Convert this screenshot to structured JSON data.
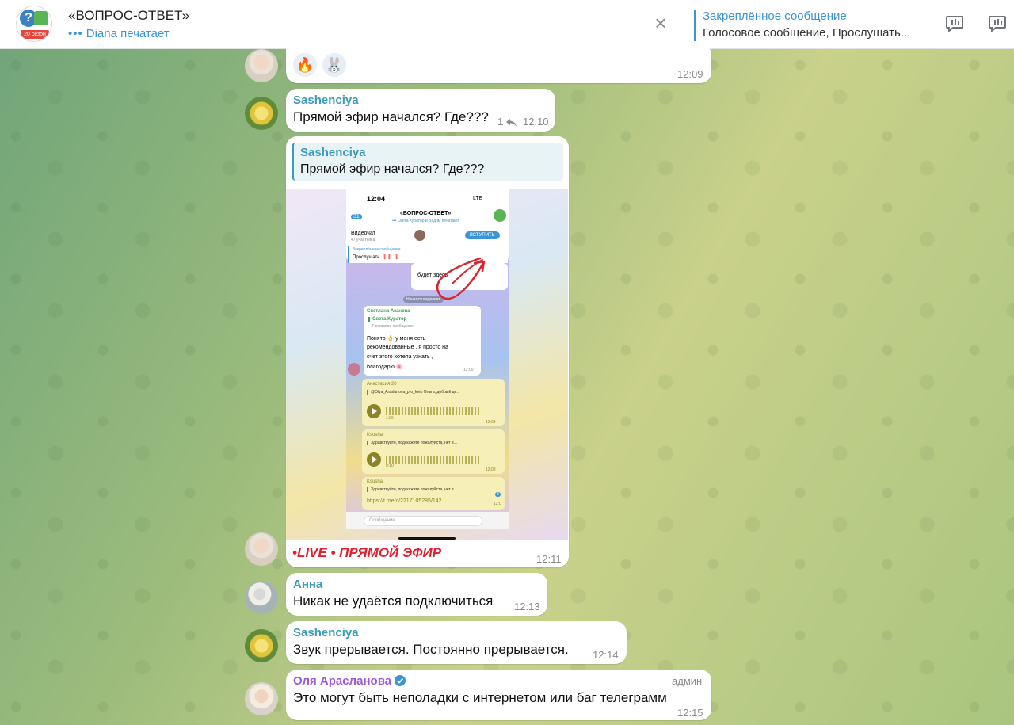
{
  "header": {
    "title": "«ВОПРОС-ОТВЕТ»",
    "status": "Diana печатает",
    "status_dots": "•••",
    "avatar_badge": "20 сезон",
    "avatar_mark": "?",
    "close_glyph": "×",
    "pinned_title": "Закреплённое сообщение",
    "pinned_text": "Голосовое сообщение, Прослушать...",
    "icons": [
      "close-icon",
      "video-chat-icon",
      "video-chat-icon"
    ]
  },
  "colors": {
    "accent": "#3a95d4",
    "sender_teal": "#3c9bb7",
    "admin_purple": "#9b5ad6",
    "live_red": "#e0202f"
  },
  "messages": [
    {
      "id": "m0",
      "reactions": [
        "🔥",
        "🐰"
      ],
      "time": "12:09"
    },
    {
      "id": "m1",
      "sender": "Sashenciya",
      "text": "Прямой эфир начался? Где???",
      "replies": "1",
      "time": "12:10"
    },
    {
      "id": "m2",
      "reply_to": {
        "sender": "Sashenciya",
        "text": "Прямой эфир начался? Где???"
      },
      "caption": "•LIVE • ПРЯМОЙ ЭФИР",
      "time": "12:11",
      "screenshot": {
        "status_time": "12:04",
        "status_net": "LTE",
        "back_count": "31",
        "title": "«ВОПРОС-ОТВЕТ»",
        "subtitle": "••• Света Куратор и Вадим печатают",
        "videochat": "Видеочат",
        "participants": "47 участника",
        "join": "ВСТУПИТЬ",
        "pinned_title": "Закреплённое сообщение",
        "pinned_text": "Прослушать ‼️‼️‼️",
        "partial": "будет здесь",
        "divider": "Начался видеочат",
        "msg1_sender": "Светлана Азанова",
        "msg1_quote_sender": "Света Куратор",
        "msg1_quote_text": "Голосовое сообщение",
        "msg1_lines": [
          "Понято 👌 у меня есть",
          "рекомендованные , я просто на",
          "счет этого хотела узнать ,",
          "благодарю 🌸"
        ],
        "msg1_time": "12:00",
        "voice1_sender": "Анастасия 20",
        "voice1_quote": "@Olya_Araslanova_pro_keto Ольга, добрый де...",
        "voice1_dur": "1:06",
        "voice1_time": "12:03",
        "voice2_sender": "Ksusha",
        "voice2_quote": "Здравствуйте, подскажите пожалуйста, нет в...",
        "voice2_dur": "0:10",
        "voice2_time": "12:03",
        "msg3_sender": "Ksusha",
        "msg3_quote": "Здравствуйте, подскажите пожалуйста, нет в...",
        "link": "https://t.me/c/2217105285/142",
        "link_time": "12:0",
        "input_placeholder": "Сообщение",
        "badge_count": "3"
      }
    },
    {
      "id": "m3",
      "sender": "Анна",
      "text": "Никак не удаётся подключиться",
      "time": "12:13"
    },
    {
      "id": "m4",
      "sender": "Sashenciya",
      "text": "Звук прерывается. Постоянно прерывается.",
      "time": "12:14"
    },
    {
      "id": "m5",
      "sender": "Оля Арасланова",
      "badge": "админ",
      "text": "Это могут быть неполадки с интернетом или баг телеграмм",
      "time": "12:15"
    }
  ]
}
